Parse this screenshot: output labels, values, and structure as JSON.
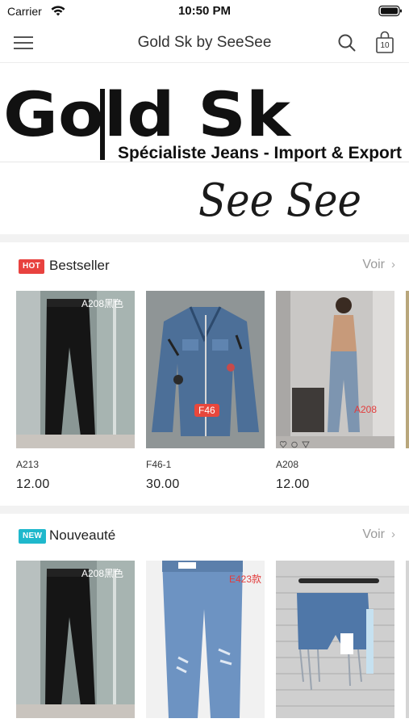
{
  "status_bar": {
    "carrier": "Carrier",
    "time": "10:50 PM"
  },
  "nav": {
    "title": "Gold Sk by SeeSee",
    "bag_count": "10"
  },
  "banner": {
    "logo_text": "Gold Sk",
    "tagline": "Spécialiste Jeans - Import & Export",
    "script_text": "See See"
  },
  "sections": [
    {
      "badge": "HOT",
      "title": "Bestseller",
      "see_all": "Voir",
      "products": [
        {
          "code": "A213",
          "price": "12.00",
          "image_tag": "A208黑色"
        },
        {
          "code": "F46-1",
          "price": "30.00",
          "image_tag": "F46"
        },
        {
          "code": "A208",
          "price": "12.00",
          "image_tag": "A208"
        }
      ]
    },
    {
      "badge": "NEW",
      "title": "Nouveauté",
      "see_all": "Voir",
      "products": [
        {
          "code": "",
          "price": "",
          "image_tag": "A208黑色"
        },
        {
          "code": "",
          "price": "",
          "image_tag": "E423款"
        },
        {
          "code": "",
          "price": "",
          "image_tag": ""
        }
      ]
    }
  ],
  "colors": {
    "hot": "#e8423f",
    "new": "#1fb8cc",
    "link_gray": "#9a9a9a"
  }
}
